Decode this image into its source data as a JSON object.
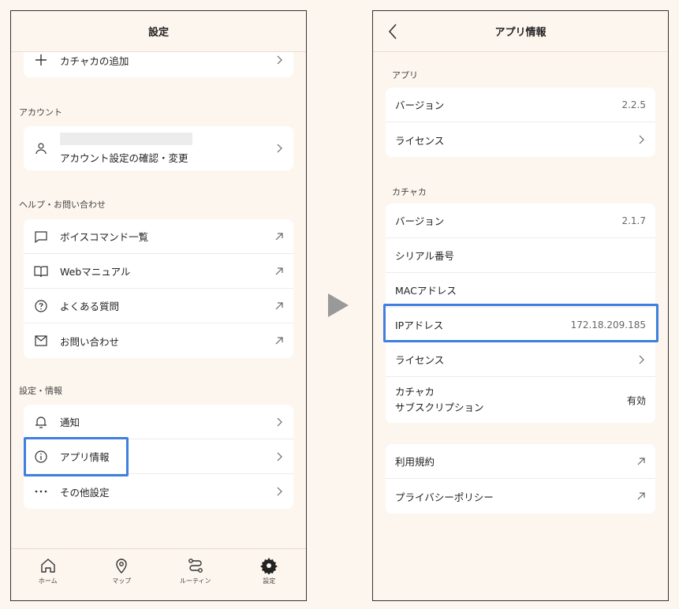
{
  "left": {
    "header_title": "設定",
    "add_item": "カチャカの追加",
    "account_section": "アカウント",
    "account_item": "アカウント設定の確認・変更",
    "help_section": "ヘルプ・お問い合わせ",
    "help_items": [
      "ボイスコマンド一覧",
      "Webマニュアル",
      "よくある質問",
      "お問い合わせ"
    ],
    "settings_section": "設定・情報",
    "settings_items": [
      "通知",
      "アプリ情報",
      "その他設定"
    ],
    "tabs": [
      "ホーム",
      "マップ",
      "ルーティン",
      "設定"
    ]
  },
  "right": {
    "header_title": "アプリ情報",
    "app_section": "アプリ",
    "app_version_label": "バージョン",
    "app_version_value": "2.2.5",
    "app_license_label": "ライセンス",
    "kachaka_section": "カチャカ",
    "k_version_label": "バージョン",
    "k_version_value": "2.1.7",
    "serial_label": "シリアル番号",
    "mac_label": "MACアドレス",
    "ip_label": "IPアドレス",
    "ip_value": "172.18.209.185",
    "k_license_label": "ライセンス",
    "subscription_label_1": "カチャカ",
    "subscription_label_2": "サブスクリプション",
    "subscription_value": "有効",
    "terms_label": "利用規約",
    "privacy_label": "プライバシーポリシー"
  },
  "colors": {
    "highlight": "#3f7fdd",
    "background": "#fdf6ee"
  },
  "icons": [
    "plus-icon",
    "user-icon",
    "chat-icon",
    "book-icon",
    "question-icon",
    "mail-icon",
    "bell-icon",
    "info-icon",
    "dots-icon",
    "home-icon",
    "map-pin-icon",
    "routine-icon",
    "gear-icon",
    "chevron-right-icon",
    "external-link-icon",
    "back-chevron-icon",
    "arrow-right-icon"
  ]
}
